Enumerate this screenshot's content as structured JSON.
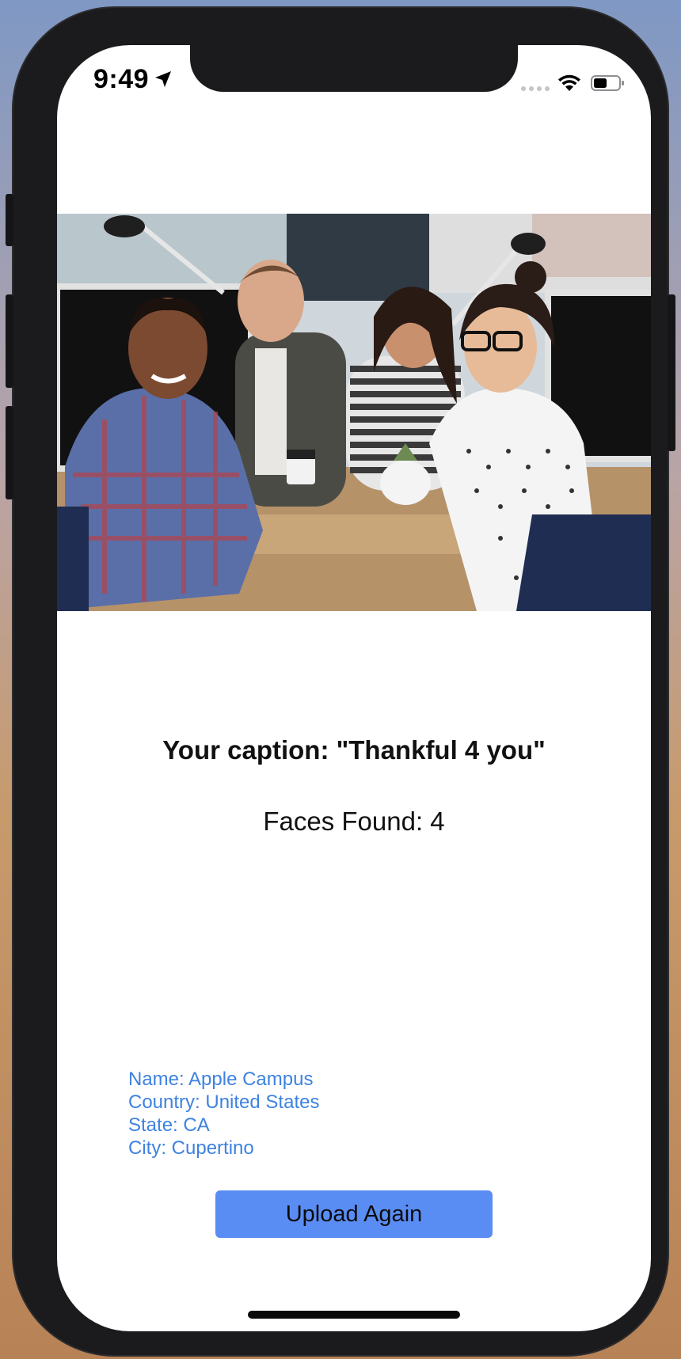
{
  "status_bar": {
    "time": "9:49"
  },
  "main": {
    "caption": "Your caption: \"Thankful 4 you\"",
    "faces_found": "Faces Found: 4",
    "location": {
      "name": "Name: Apple Campus",
      "country": "Country: United States",
      "state": "State: CA",
      "city": "City: Cupertino"
    },
    "upload_button_label": "Upload Again"
  },
  "colors": {
    "accent_button": "#5a8df4",
    "info_text": "#3e82e0"
  }
}
